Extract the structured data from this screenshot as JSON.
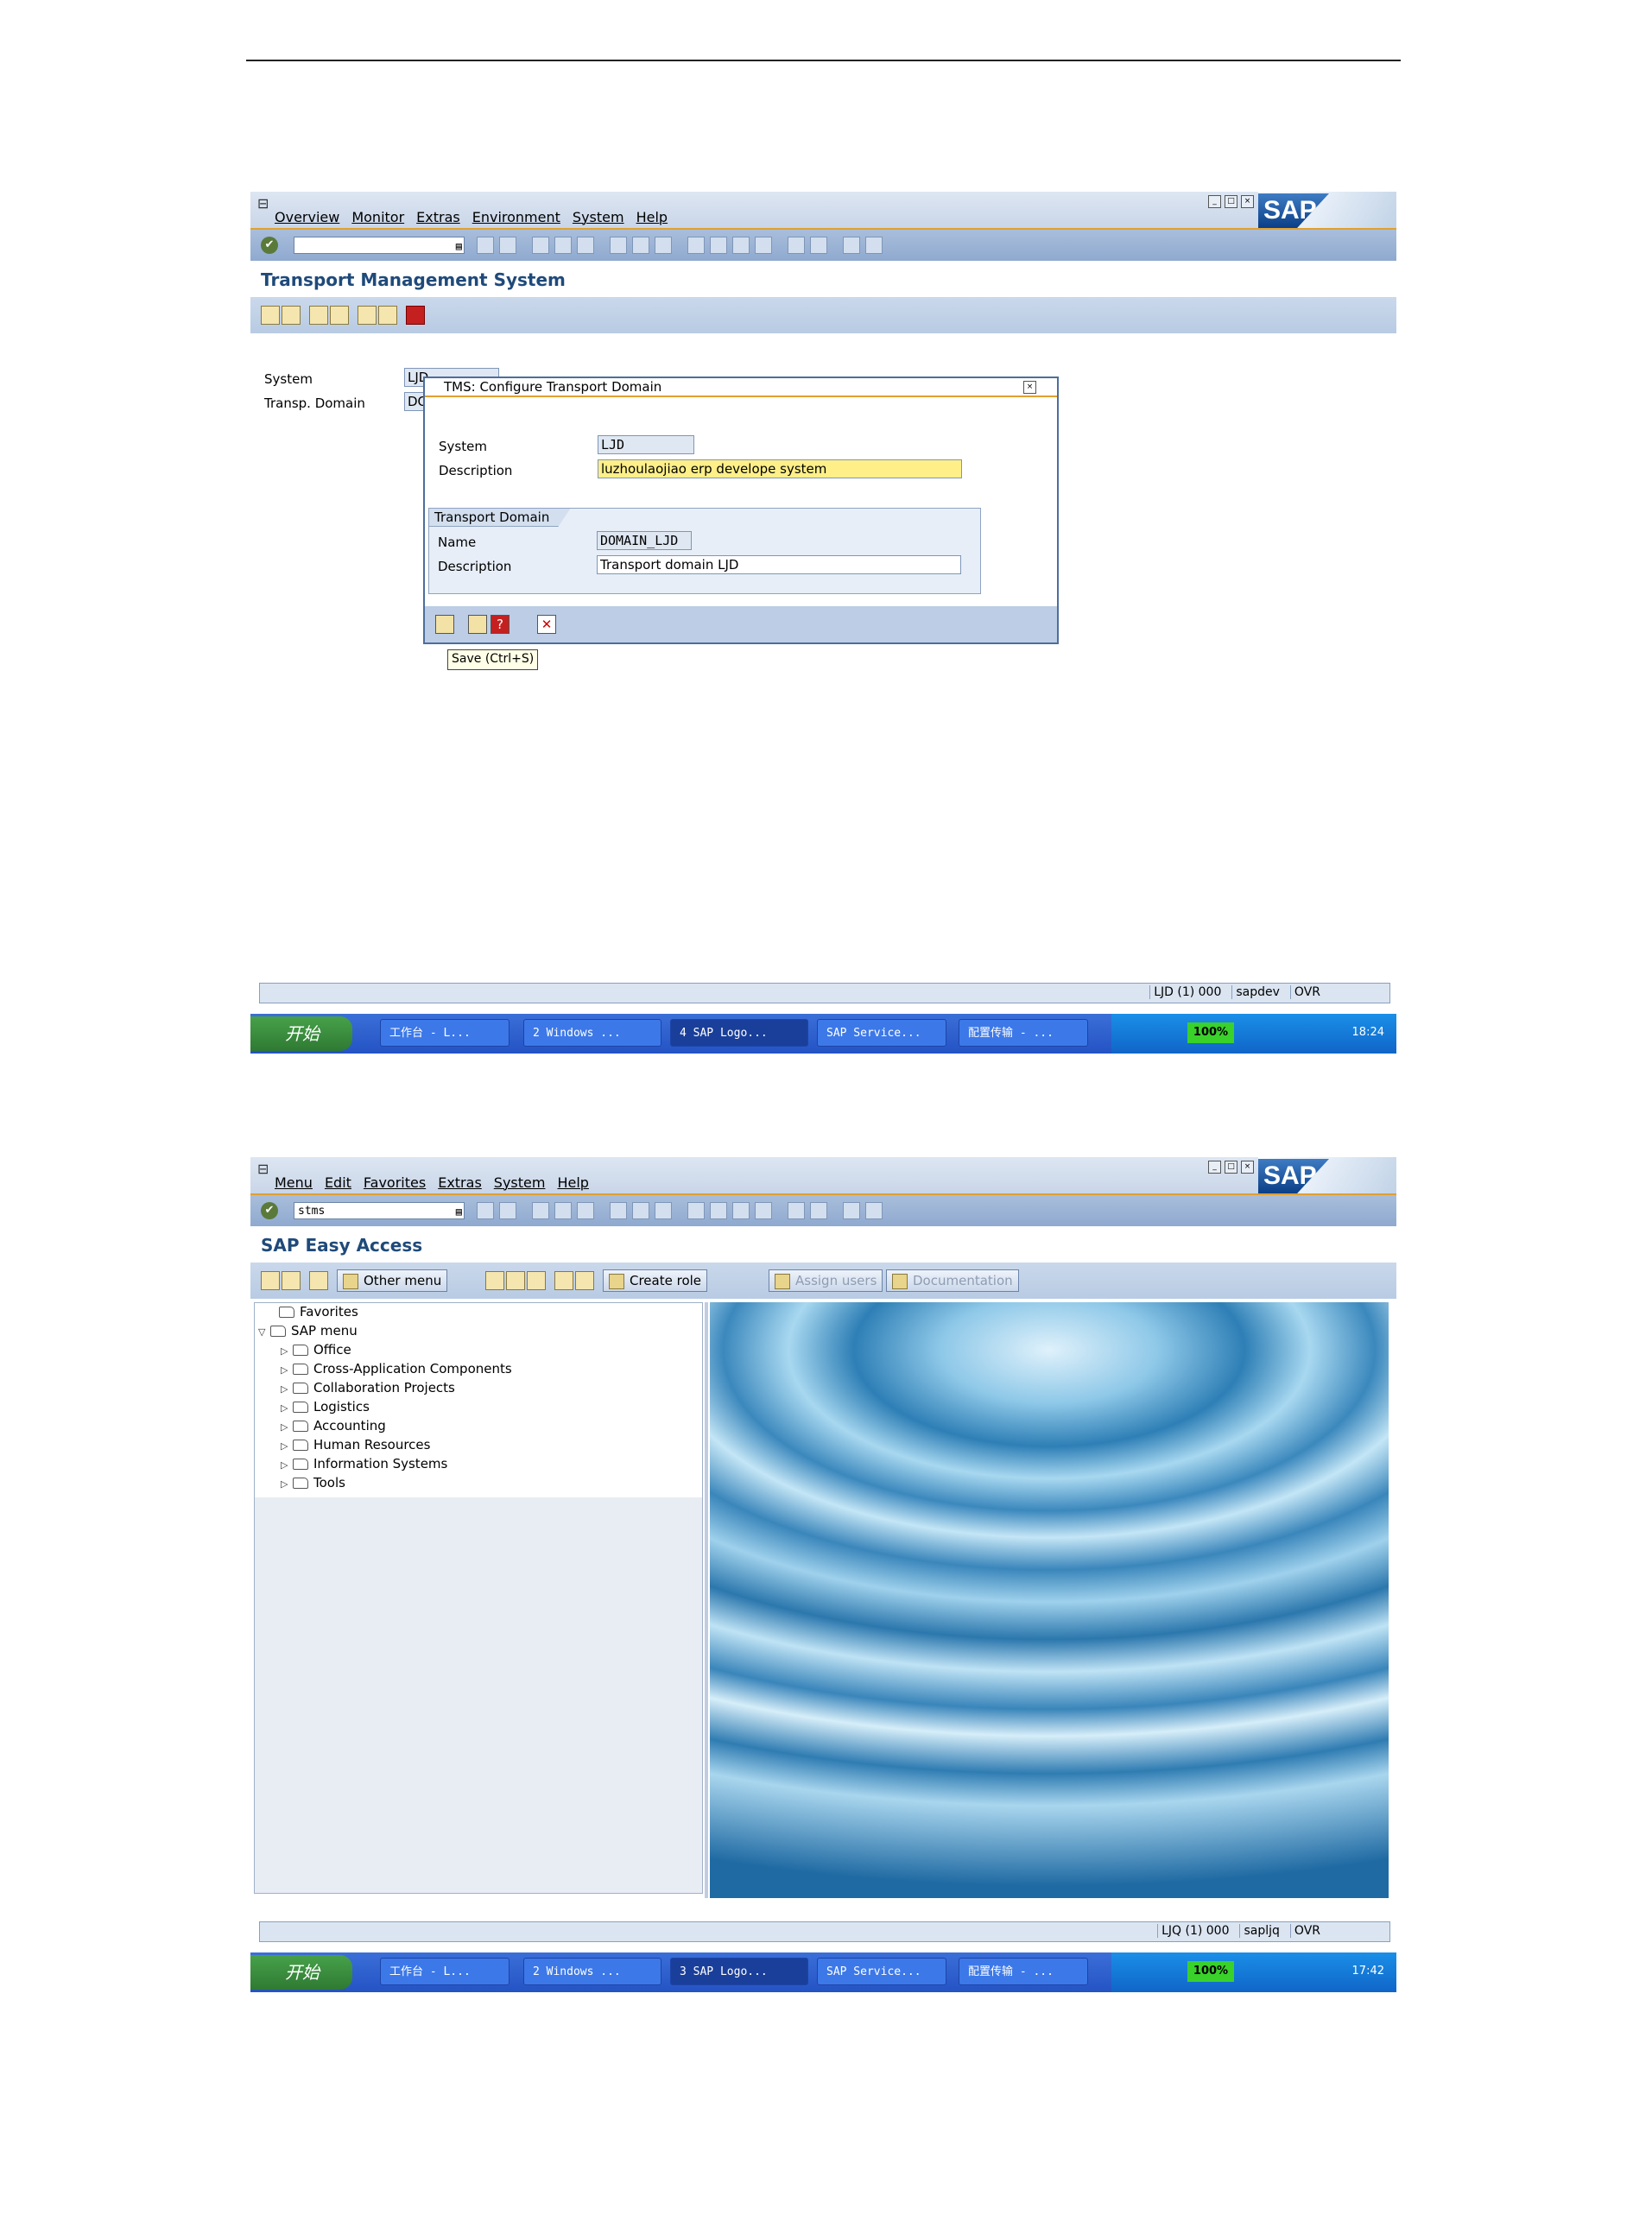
{
  "screen1": {
    "menu": [
      "Overview",
      "Monitor",
      "Extras",
      "Environment",
      "System",
      "Help"
    ],
    "command_field": "",
    "title": "Transport Management System",
    "main": {
      "system_label": "System",
      "system_value": "LJD",
      "domain_label": "Transp. Domain",
      "domain_value": "DO"
    },
    "dialog": {
      "title": "TMS: Configure Transport Domain",
      "system_label": "System",
      "system_value": "LJD",
      "description_label": "Description",
      "description_value": "luzhoulaojiao erp develope system",
      "group_title": "Transport Domain",
      "name_label": "Name",
      "name_value": "DOMAIN_LJD",
      "domain_description_label": "Description",
      "domain_description_value": "Transport domain LJD"
    },
    "tooltip": "Save   (Ctrl+S)",
    "status": {
      "system": "LJD (1) 000",
      "server": "sapdev",
      "mode": "OVR"
    },
    "taskbar": {
      "start": "开始",
      "buttons": [
        "工作台 - L...",
        "2 Windows ...",
        "4 SAP Logo...",
        "SAP Service...",
        "配置传输 - ..."
      ],
      "zoom": "100%",
      "clock": "18:24"
    }
  },
  "screen2": {
    "menu": [
      "Menu",
      "Edit",
      "Favorites",
      "Extras",
      "System",
      "Help"
    ],
    "command_field": "stms",
    "title": "SAP Easy Access",
    "toolbar_buttons": [
      "Other menu",
      "Create role",
      "Assign users",
      "Documentation"
    ],
    "tree": {
      "favorites": "Favorites",
      "sap_menu": "SAP menu",
      "items": [
        "Office",
        "Cross-Application Components",
        "Collaboration Projects",
        "Logistics",
        "Accounting",
        "Human Resources",
        "Information Systems",
        "Tools"
      ]
    },
    "status": {
      "system": "LJQ (1) 000",
      "server": "sapljq",
      "mode": "OVR"
    },
    "taskbar": {
      "start": "开始",
      "buttons": [
        "工作台 - L...",
        "2 Windows ...",
        "3 SAP Logo...",
        "SAP Service...",
        "配置传输 - ..."
      ],
      "zoom": "100%",
      "clock": "17:42"
    }
  },
  "colors": {
    "sap_blue": "#1f4a7a",
    "toolbar": "#8da8cf",
    "accent_orange": "#e0a030",
    "focus_yellow": "#ffef88",
    "taskbar_blue": "#2453c4"
  }
}
